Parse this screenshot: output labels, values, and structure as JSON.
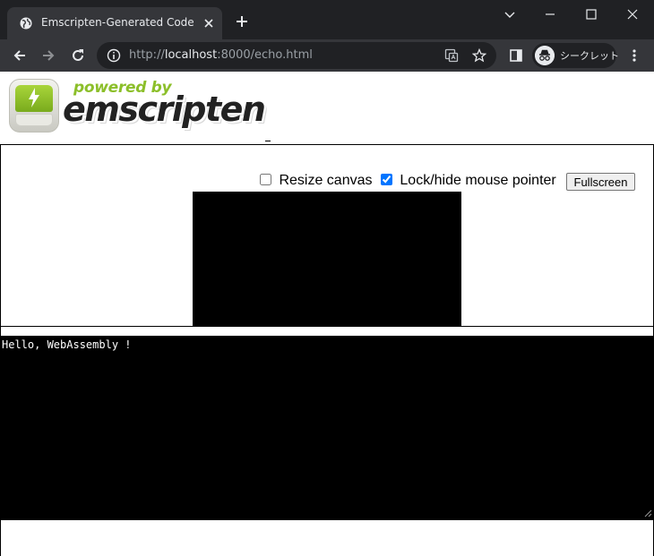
{
  "browser": {
    "tab_title": "Emscripten-Generated Code",
    "url_scheme": "http://",
    "url_host": "localhost",
    "url_rest": ":8000/echo.html",
    "incognito_label": "シークレット"
  },
  "logo": {
    "powered_by": "powered by",
    "brand": "emscripten"
  },
  "controls": {
    "resize_label": "Resize canvas",
    "resize_checked": false,
    "lock_label": "Lock/hide mouse pointer",
    "lock_checked": true,
    "fullscreen_label": "Fullscreen"
  },
  "output": {
    "text": "Hello, WebAssembly !"
  }
}
